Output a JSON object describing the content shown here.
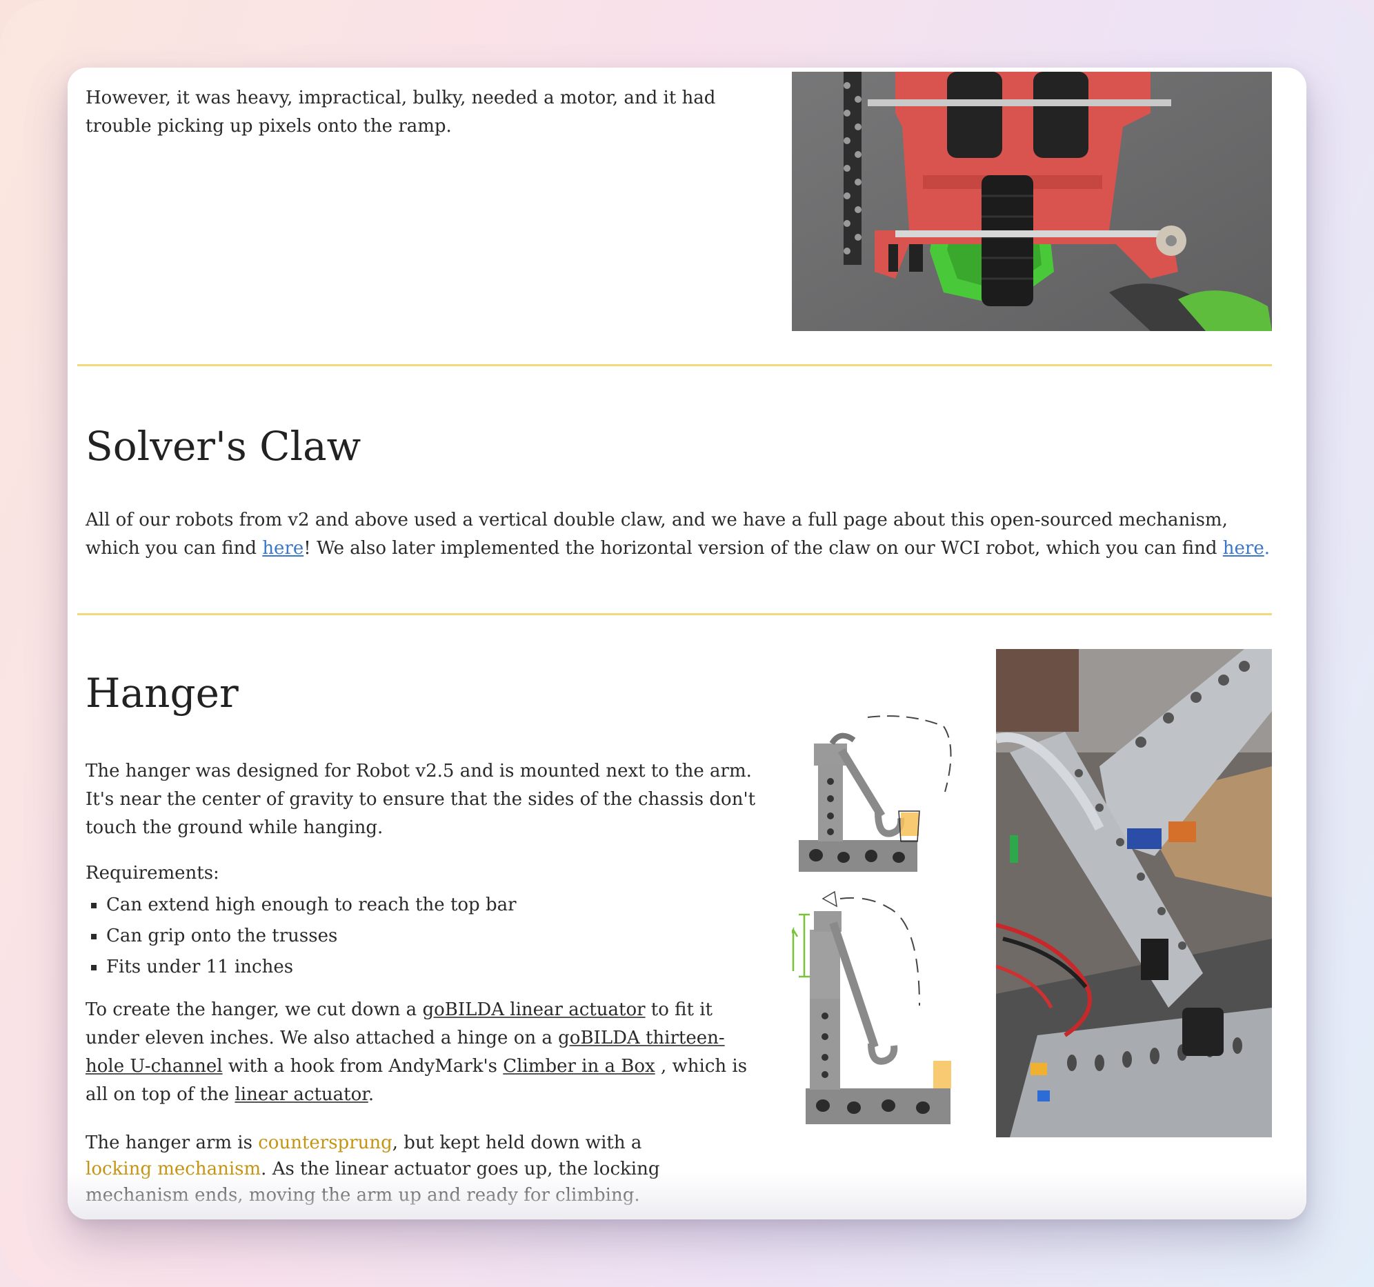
{
  "intro": {
    "text": "However, it was heavy, impractical, bulky, needed a motor, and it had trouble picking up pixels onto the ramp."
  },
  "claw_section": {
    "heading": "Solver's Claw",
    "para_part1": "All of our robots from v2 and above used a vertical double claw, and we have a full page about this open-sourced mechanism, which you can find ",
    "link1": "here",
    "para_part2": "! We also later implemented the horizontal version of the claw on our WCI robot, which you can find ",
    "link2": "here",
    "para_part3": "."
  },
  "hanger_section": {
    "heading": "Hanger",
    "para1": "The hanger was designed for Robot v2.5 and is mounted next to the arm. It's near the center of gravity to ensure that the sides of the chassis don't touch the ground while hanging.",
    "requirements_label": "Requirements:",
    "requirements": [
      "Can extend high enough to reach the top bar",
      "Can grip onto the trusses",
      "Fits under 11 inches"
    ],
    "para2_a": "To create the hanger, we cut down a ",
    "link_actuator": "goBILDA linear actuator",
    "para2_b": " to fit it under eleven inches. We also attached a hinge on a ",
    "link_uchannel": "goBILDA thirteen-hole U-channel",
    "para2_c": " with a hook from AndyMark's ",
    "link_climber": "Climber in a Box",
    "para2_d": " , which is all on top of the ",
    "link_linear": "linear actuator",
    "para2_e": ".",
    "para3_a": "The hanger arm is ",
    "term_countersprung": "countersprung",
    "para3_b": ", but kept held down with a ",
    "term_locking": "locking mechanism",
    "para3_c": ". As the linear actuator goes up, the locking mechanism ends, moving the arm up and ready for climbing."
  },
  "colors": {
    "divider": "#f3da79",
    "link_blue": "#3a76c9",
    "highlight_gold": "#c59412"
  },
  "icons": [
    "intake-photo",
    "hanger-sketch",
    "hanger-photo"
  ]
}
